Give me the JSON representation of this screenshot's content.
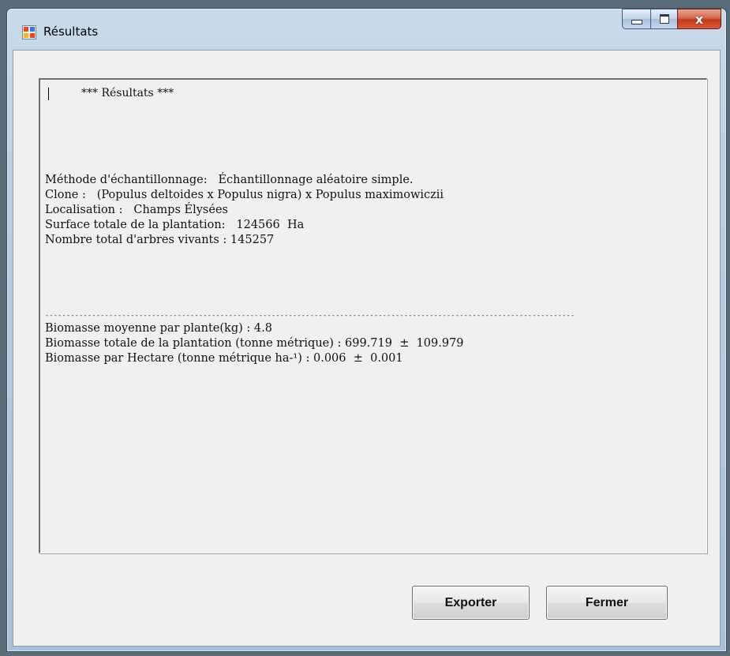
{
  "window": {
    "title": "Résultats",
    "caption": {
      "close_glyph": "x"
    }
  },
  "results": {
    "heading": "*** Résultats ***",
    "method_label": "Méthode d'échantillonnage:",
    "method_value": "Échantillonnage aléatoire simple.",
    "clone_label": "Clone :",
    "clone_value": "(Populus deltoides x Populus nigra) x Populus maximowiczii",
    "location_label": "Localisation :",
    "location_value": "Champs Élysées",
    "area_label": "Surface totale de la plantation:",
    "area_value": "124566",
    "area_unit": "Ha",
    "trees_label": "Nombre total d'arbres vivants :",
    "trees_value": "145257",
    "separator": "----------------------------------------------------------------------------------------------------------------------------",
    "biomass_mean_label": "Biomasse moyenne par plante(kg) :",
    "biomass_mean_value": "4.8",
    "biomass_total_label": "Biomasse totale de la plantation (tonne métrique) :",
    "biomass_total_value": "699.719",
    "biomass_total_error": "109.979",
    "biomass_ha_label": "Biomasse par Hectare (tonne métrique ha-¹) :",
    "biomass_ha_value": "0.006",
    "biomass_ha_error": "0.001",
    "plus_minus": "±"
  },
  "buttons": {
    "export_label": "Exporter",
    "close_label": "Fermer"
  }
}
